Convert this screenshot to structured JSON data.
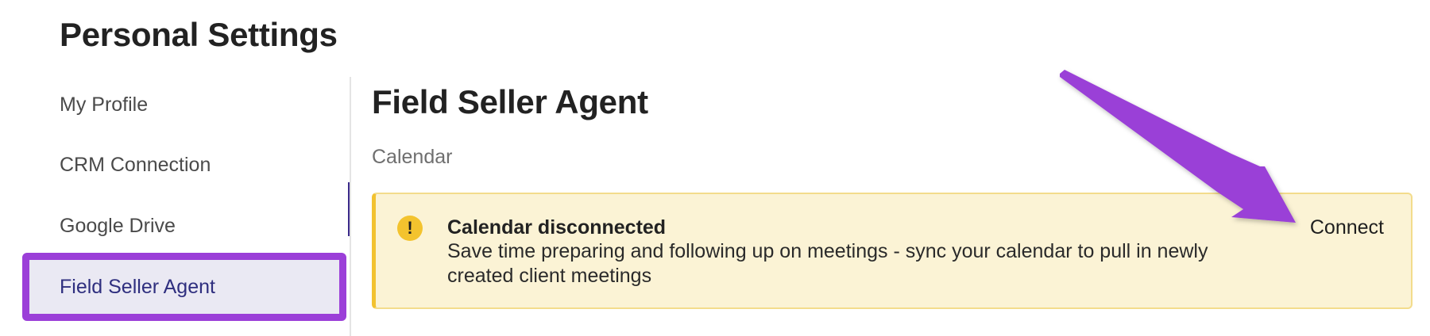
{
  "page": {
    "title": "Personal Settings"
  },
  "sidebar": {
    "items": [
      {
        "label": "My Profile"
      },
      {
        "label": "CRM Connection"
      },
      {
        "label": "Google Drive"
      },
      {
        "label": "Field Seller Agent",
        "active": true
      }
    ]
  },
  "main": {
    "title": "Field Seller Agent",
    "subsection": "Calendar",
    "alert": {
      "icon": "exclamation-icon",
      "icon_glyph": "!",
      "title": "Calendar disconnected",
      "message": "Save time preparing and following up on meetings - sync your calendar to pull in newly created client meetings",
      "action_label": "Connect"
    }
  },
  "colors": {
    "highlight": "#9b3fd8",
    "alert_background": "#fbf3d5",
    "alert_border": "#f2c230",
    "active_text": "#2f2f7f"
  }
}
